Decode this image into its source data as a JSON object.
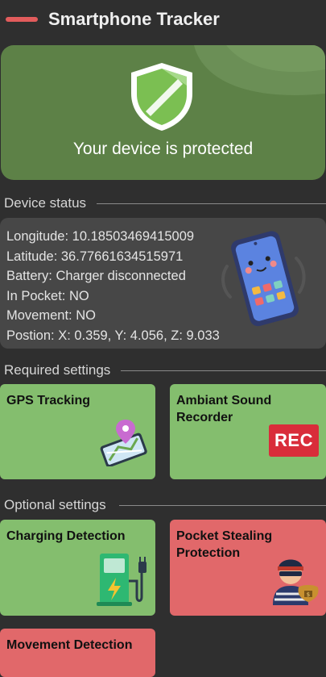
{
  "header": {
    "title": "Smartphone Tracker",
    "accent": "#e25c5c"
  },
  "hero": {
    "message": "Your device is protected",
    "bg": "#5d8147"
  },
  "device_status": {
    "title": "Device status",
    "lines": [
      "Longitude: 10.18503469415009",
      "Latitude: 36.77661634515971",
      "Battery: Charger disconnected",
      "In Pocket: NO",
      "Movement: NO",
      "Postion: X: 0.359, Y: 4.056, Z: 9.033"
    ]
  },
  "required_settings": {
    "title": "Required settings",
    "tiles": [
      {
        "label": "GPS Tracking",
        "state_color": "#84be6e",
        "icon": "gps-map-icon"
      },
      {
        "label": "Ambiant Sound\nRecorder",
        "state_color": "#84be6e",
        "icon": "rec-icon",
        "icon_text": "REC"
      }
    ]
  },
  "optional_settings": {
    "title": "Optional settings",
    "tiles": [
      {
        "label": "Charging Detection",
        "state_color": "#84be6e",
        "icon": "charging-station-icon"
      },
      {
        "label": "Pocket Stealing\nProtection",
        "state_color": "#e1686a",
        "icon": "thief-icon"
      },
      {
        "label": "Movement Detection",
        "state_color": "#e1686a",
        "icon": "movement-icon"
      }
    ]
  }
}
